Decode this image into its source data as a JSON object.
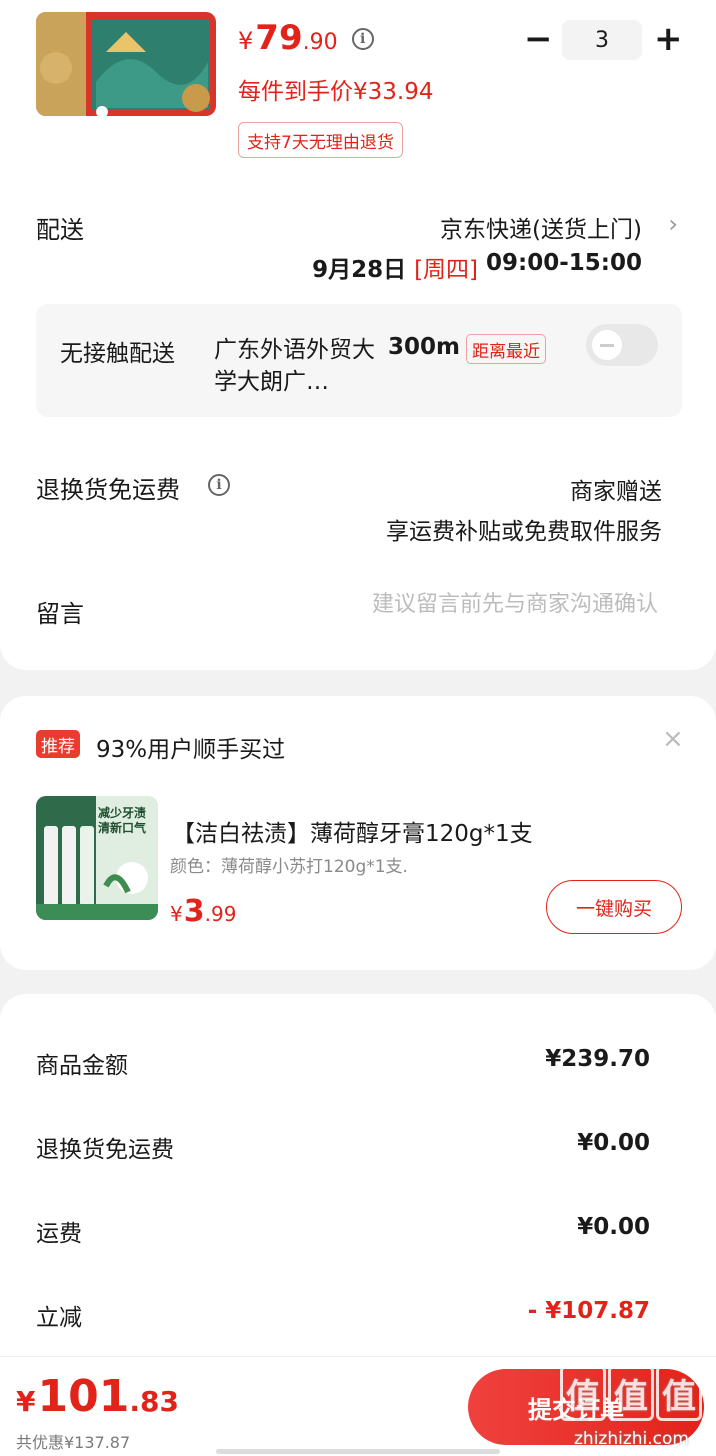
{
  "product": {
    "price_symbol": "¥",
    "price_int": "79",
    "price_dec": ".90",
    "info_icon": "info-icon",
    "per_item_price": "每件到手价¥33.94",
    "return_tag": "支持7天无理由退货",
    "qty_minus": "−",
    "quantity": "3",
    "qty_plus": "+"
  },
  "delivery": {
    "label": "配送",
    "method": "京东快递(送货上门)",
    "chevron": "›",
    "date": "9月28日",
    "weekday": "[周四]",
    "time": "09:00-15:00"
  },
  "contactless": {
    "label": "无接触配送",
    "address": "广东外语外贸大学大朗广…",
    "distance": "300m",
    "nearest_tag": "距离最近",
    "enabled": false
  },
  "return_shipping": {
    "label": "退换货免运费",
    "value": "商家赠送",
    "sub": "享运费补贴或免费取件服务"
  },
  "message": {
    "label": "留言",
    "placeholder": "建议留言前先与商家沟通确认"
  },
  "recommend": {
    "tag": "推荐",
    "title": "93%用户顺手买过",
    "close": "×",
    "product_name": "【洁白祛渍】薄荷醇牙膏120g*1支",
    "spec": "颜色：薄荷醇小苏打120g*1支.",
    "price_symbol": "¥",
    "price_int": "3",
    "price_dec": ".99",
    "buy_label": "一键购买",
    "image_text_1": "减少牙渍",
    "image_text_2": "清新口气"
  },
  "summary": [
    {
      "label": "商品金额",
      "value": "¥239.70"
    },
    {
      "label": "退换货免运费",
      "value": "¥0.00"
    },
    {
      "label": "运费",
      "value": "¥0.00"
    },
    {
      "label": "立减",
      "value": "- ¥107.87"
    }
  ],
  "bottom": {
    "total_symbol": "¥",
    "total_int": "101",
    "total_dec": ".83",
    "saved": "共优惠¥137.87",
    "submit_label": "提交订单",
    "watermark_chars": [
      "值",
      "值",
      "值"
    ],
    "watermark_url": "zhizhizhi.com"
  },
  "colors": {
    "accent": "#e2231a",
    "background": "#f2f2f2"
  }
}
